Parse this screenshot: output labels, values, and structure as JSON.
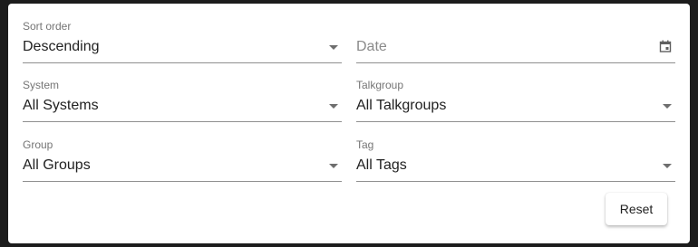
{
  "filters": {
    "sort_order": {
      "label": "Sort order",
      "value": "Descending"
    },
    "date": {
      "placeholder": "Date"
    },
    "system": {
      "label": "System",
      "value": "All Systems"
    },
    "talkgroup": {
      "label": "Talkgroup",
      "value": "All Talkgroups"
    },
    "group": {
      "label": "Group",
      "value": "All Groups"
    },
    "tag": {
      "label": "Tag",
      "value": "All Tags"
    }
  },
  "actions": {
    "reset_label": "Reset"
  },
  "icons": {
    "dropdown": "chevron-down-icon",
    "date": "calendar-icon"
  }
}
